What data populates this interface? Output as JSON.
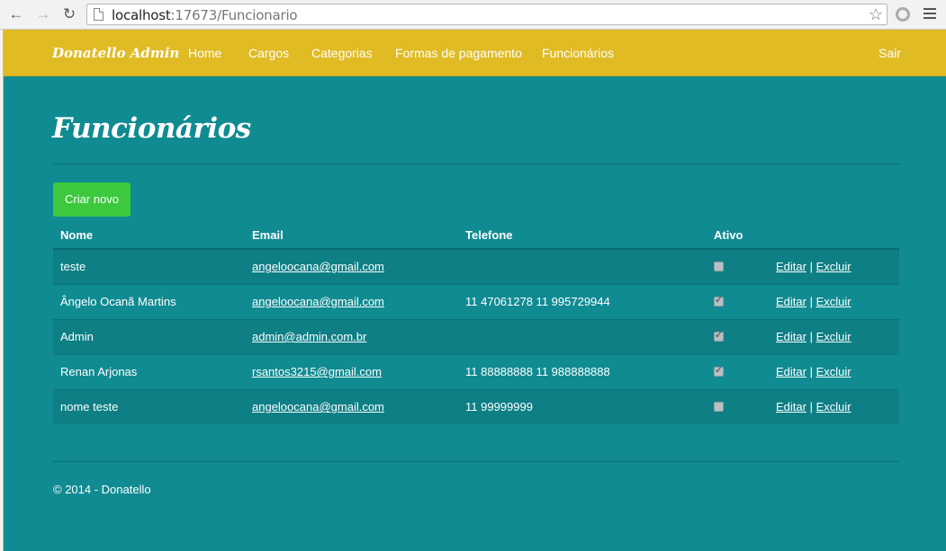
{
  "browser": {
    "url_host": "localhost",
    "url_path": ":17673/Funcionario"
  },
  "navbar": {
    "brand": "Donatello Admin",
    "links": [
      "Home",
      "Cargos",
      "Categorias",
      "Formas de pagamento",
      "Funcionários"
    ],
    "logout": "Sair"
  },
  "page": {
    "title": "Funcionários",
    "create_button": "Criar novo"
  },
  "table": {
    "headers": [
      "Nome",
      "Email",
      "Telefone",
      "Ativo"
    ],
    "rows": [
      {
        "nome": "teste",
        "email": "angeloocana@gmail.com",
        "telefone": "",
        "ativo": false,
        "edit": "Editar",
        "delete": "Excluir"
      },
      {
        "nome": "Ângelo Ocanã Martins",
        "email": "angeloocana@gmail.com",
        "telefone": "11 47061278 11 995729944",
        "ativo": true,
        "edit": "Editar",
        "delete": "Excluir"
      },
      {
        "nome": "Admin",
        "email": "admin@admin.com.br",
        "telefone": "",
        "ativo": true,
        "edit": "Editar",
        "delete": "Excluir"
      },
      {
        "nome": "Renan Arjonas",
        "email": "rsantos3215@gmail.com",
        "telefone": "11 88888888 11 988888888",
        "ativo": true,
        "edit": "Editar",
        "delete": "Excluir"
      },
      {
        "nome": "nome teste",
        "email": "angeloocana@gmail.com",
        "telefone": "11 99999999",
        "ativo": false,
        "edit": "Editar",
        "delete": "Excluir"
      }
    ],
    "separator": "|"
  },
  "footer": {
    "text": "© 2014 - Donatello"
  },
  "colors": {
    "navbar": "#e0bb24",
    "background": "#108b92",
    "button": "#3dc93d"
  }
}
